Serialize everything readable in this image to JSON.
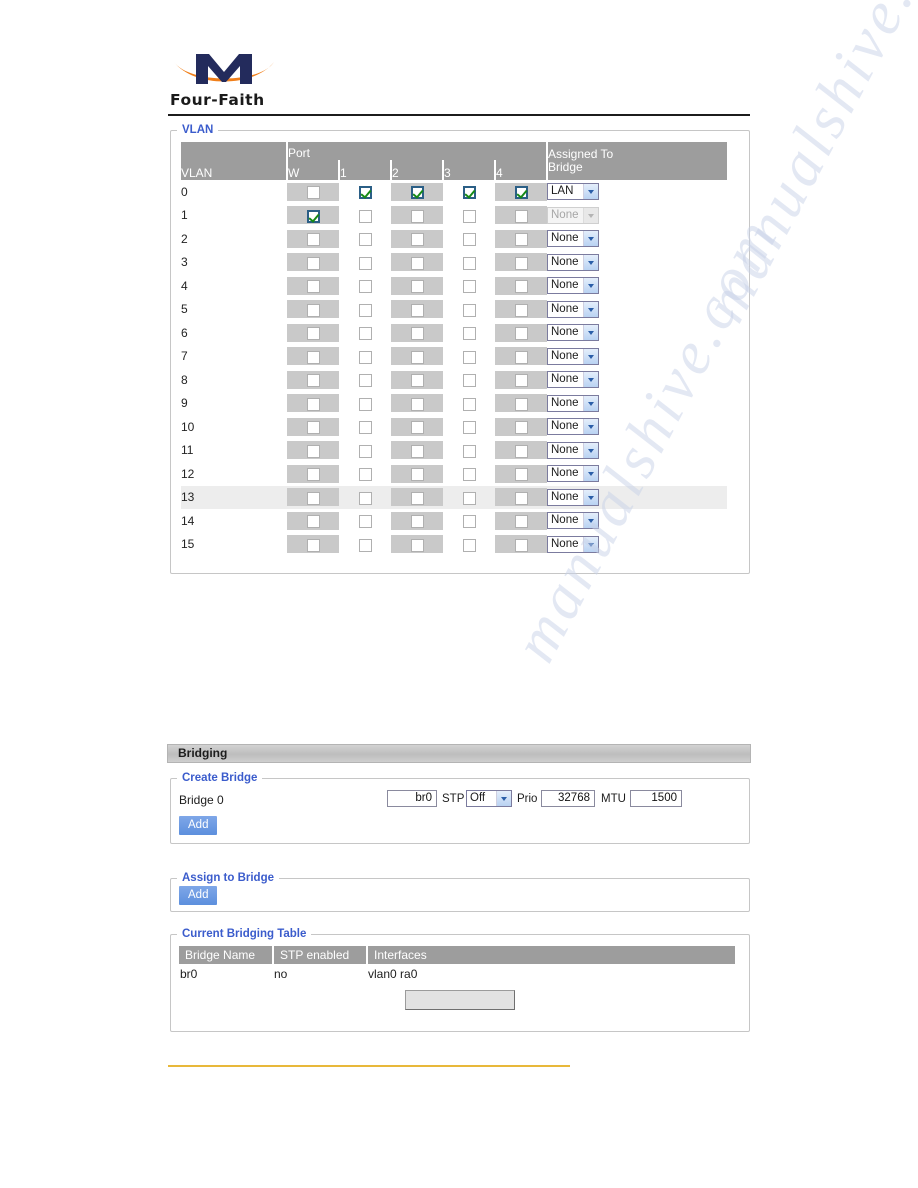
{
  "brand": {
    "name": "Four-Faith",
    "logo_icon": "four-faith-logo-icon"
  },
  "vlan": {
    "legend": "VLAN",
    "headers": {
      "vlan": "VLAN",
      "port_group": "Port",
      "ports": [
        "W",
        "1",
        "2",
        "3",
        "4"
      ],
      "assigned_to_bridge": "Assigned To Bridge",
      "assigned_to_bridge_line1": "Assigned To",
      "assigned_to_bridge_line2": "Bridge"
    },
    "rows": [
      {
        "vlan": "0",
        "ports": [
          false,
          true,
          true,
          true,
          true
        ],
        "bridge": "LAN",
        "disabled": false,
        "highlight": false
      },
      {
        "vlan": "1",
        "ports": [
          true,
          false,
          false,
          false,
          false
        ],
        "bridge": "None",
        "disabled": true,
        "highlight": false
      },
      {
        "vlan": "2",
        "ports": [
          false,
          false,
          false,
          false,
          false
        ],
        "bridge": "None",
        "disabled": false,
        "highlight": false
      },
      {
        "vlan": "3",
        "ports": [
          false,
          false,
          false,
          false,
          false
        ],
        "bridge": "None",
        "disabled": false,
        "highlight": false
      },
      {
        "vlan": "4",
        "ports": [
          false,
          false,
          false,
          false,
          false
        ],
        "bridge": "None",
        "disabled": false,
        "highlight": false
      },
      {
        "vlan": "5",
        "ports": [
          false,
          false,
          false,
          false,
          false
        ],
        "bridge": "None",
        "disabled": false,
        "highlight": false
      },
      {
        "vlan": "6",
        "ports": [
          false,
          false,
          false,
          false,
          false
        ],
        "bridge": "None",
        "disabled": false,
        "highlight": false
      },
      {
        "vlan": "7",
        "ports": [
          false,
          false,
          false,
          false,
          false
        ],
        "bridge": "None",
        "disabled": false,
        "highlight": false
      },
      {
        "vlan": "8",
        "ports": [
          false,
          false,
          false,
          false,
          false
        ],
        "bridge": "None",
        "disabled": false,
        "highlight": false
      },
      {
        "vlan": "9",
        "ports": [
          false,
          false,
          false,
          false,
          false
        ],
        "bridge": "None",
        "disabled": false,
        "highlight": false
      },
      {
        "vlan": "10",
        "ports": [
          false,
          false,
          false,
          false,
          false
        ],
        "bridge": "None",
        "disabled": false,
        "highlight": false
      },
      {
        "vlan": "11",
        "ports": [
          false,
          false,
          false,
          false,
          false
        ],
        "bridge": "None",
        "disabled": false,
        "highlight": false
      },
      {
        "vlan": "12",
        "ports": [
          false,
          false,
          false,
          false,
          false
        ],
        "bridge": "None",
        "disabled": false,
        "highlight": false
      },
      {
        "vlan": "13",
        "ports": [
          false,
          false,
          false,
          false,
          false
        ],
        "bridge": "None",
        "disabled": false,
        "highlight": true
      },
      {
        "vlan": "14",
        "ports": [
          false,
          false,
          false,
          false,
          false
        ],
        "bridge": "None",
        "disabled": false,
        "highlight": false
      },
      {
        "vlan": "15",
        "ports": [
          false,
          false,
          false,
          false,
          false
        ],
        "bridge": "None",
        "disabled": false,
        "highlight": false
      }
    ]
  },
  "bridging": {
    "section_title": "Bridging",
    "create_bridge": {
      "legend": "Create Bridge",
      "bridge_label": "Bridge 0",
      "name_value": "br0",
      "stp_label": "STP",
      "stp_value": "Off",
      "prio_label": "Prio",
      "prio_value": "32768",
      "mtu_label": "MTU",
      "mtu_value": "1500",
      "add_label": "Add"
    },
    "assign_to_bridge": {
      "legend": "Assign to Bridge",
      "add_label": "Add"
    },
    "current_table": {
      "legend": "Current Bridging Table",
      "headers": [
        "Bridge Name",
        "STP enabled",
        "Interfaces"
      ],
      "rows": [
        {
          "bridge_name": "br0",
          "stp_enabled": "no",
          "interfaces": "vlan0 ra0"
        }
      ],
      "action_label": ""
    }
  },
  "watermark": {
    "line1": "manualshive.com",
    "line2": "manualshive.com"
  },
  "colors": {
    "legend_blue": "#3b5ccc",
    "header_grey": "#9d9d9d",
    "checkbox_check_green": "#168a16",
    "add_button_blue": "#5c8fdd",
    "footer_rule_gold": "#e8b83a",
    "logo_navy": "#232b5c",
    "logo_orange": "#f07f1a"
  }
}
